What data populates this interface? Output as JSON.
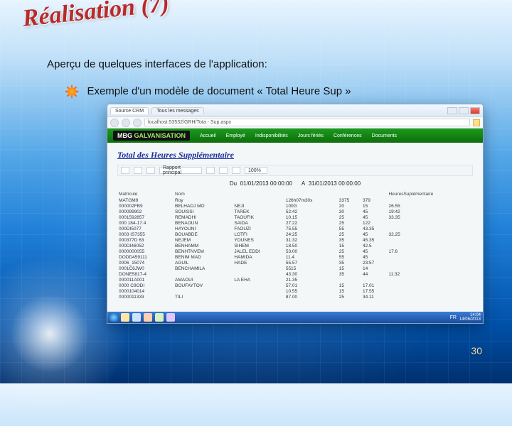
{
  "slide": {
    "title": "Réalisation (7)",
    "subtitle": "Aperçu de quelques interfaces de l'application:",
    "bullet": "Exemple d'un  modèle de document « Total Heure Sup »",
    "page_number": "30"
  },
  "browser": {
    "tab1": "Source CRM",
    "tab2": "Tous les messages",
    "url": "localhost:53532/GRH/Tota - Sup.aspx",
    "logo_main": "MBG",
    "logo_sub": "GALVANISATION",
    "nav": [
      "Accueil",
      "Employé",
      "Indisponibilités",
      "Jours fériés",
      "Conférences",
      "Documents"
    ]
  },
  "report": {
    "title": "Total des Heures Supplémentaire",
    "toolbar_label": "Rapport principal",
    "zoom": "100%",
    "period_from_label": "Du",
    "period_from": "01/01/2013 00:00:00",
    "period_to_label": "A",
    "period_to": "31/01/2013 00:00:00",
    "headers": [
      "Matricule",
      "Nom",
      "",
      "",
      "",
      "",
      "HeuresSuplémentaire"
    ],
    "rows": [
      [
        "MATGM9",
        "Roy",
        "",
        "126h07m30s",
        "3375",
        "379",
        ""
      ],
      [
        "000002FB9",
        "BELHADJ MO",
        "NEJI",
        "100G",
        "20",
        "15",
        "26.55"
      ],
      [
        "000099902",
        "SOUISSI",
        "TAREK",
        "52:42",
        "30",
        "45",
        "19:42"
      ],
      [
        "0001592857",
        "REMADHI",
        "TAOUFIK",
        "10.15",
        "25",
        "45",
        "33.35"
      ],
      [
        "000 184-17.4",
        "BENAOUN",
        "SAIDA",
        "27:22",
        "25",
        "122",
        ""
      ],
      [
        "000DI5077",
        "HAYOUNI",
        "FAOUZI",
        "75.55",
        "55",
        "43.35",
        ""
      ],
      [
        "0003 IS7355",
        "BOUABDE",
        "LOTFI",
        "24:25",
        "25",
        "45",
        "32.25"
      ],
      [
        "000377D 63",
        "NEJEM",
        "YOUNES",
        "31:32",
        "35",
        "45.35",
        ""
      ],
      [
        "000DI46052",
        "BENHAMM",
        "SIHEM",
        "18.50",
        "15",
        "42.5",
        ""
      ],
      [
        "0000000055",
        "BENHTNVEM",
        "JALEL EDDI",
        "53:00",
        "25",
        "45",
        "17.6"
      ],
      [
        "DODD459111",
        "BENIM MAD",
        "HAMIDA",
        "11.4",
        "55",
        "45",
        ""
      ],
      [
        "0006_15074",
        "AGUIL",
        "HADE",
        "55.57",
        "35",
        "23:57",
        ""
      ],
      [
        "0001C6JW0",
        "BENCHAMILA",
        "",
        "5515",
        "15",
        "14",
        ""
      ],
      [
        "DONE5817-4",
        "",
        "",
        "43:30",
        "35",
        "44",
        "11:32"
      ],
      [
        "000011A001",
        "AMAOUI",
        "LA EHA",
        "21.35",
        "",
        "",
        ""
      ],
      [
        "0000 C9ODI",
        "BOUFAYTOV",
        "",
        "57.01",
        "15",
        "17.01",
        ""
      ],
      [
        "0000104014",
        "",
        "",
        "10.55",
        "15",
        "17.55",
        ""
      ],
      [
        "0000011333",
        "TILI",
        "",
        "87.00",
        "25",
        "34.11",
        ""
      ]
    ]
  },
  "taskbar": {
    "lang": "FR",
    "time": "14:04",
    "date": "14/06/2013"
  }
}
